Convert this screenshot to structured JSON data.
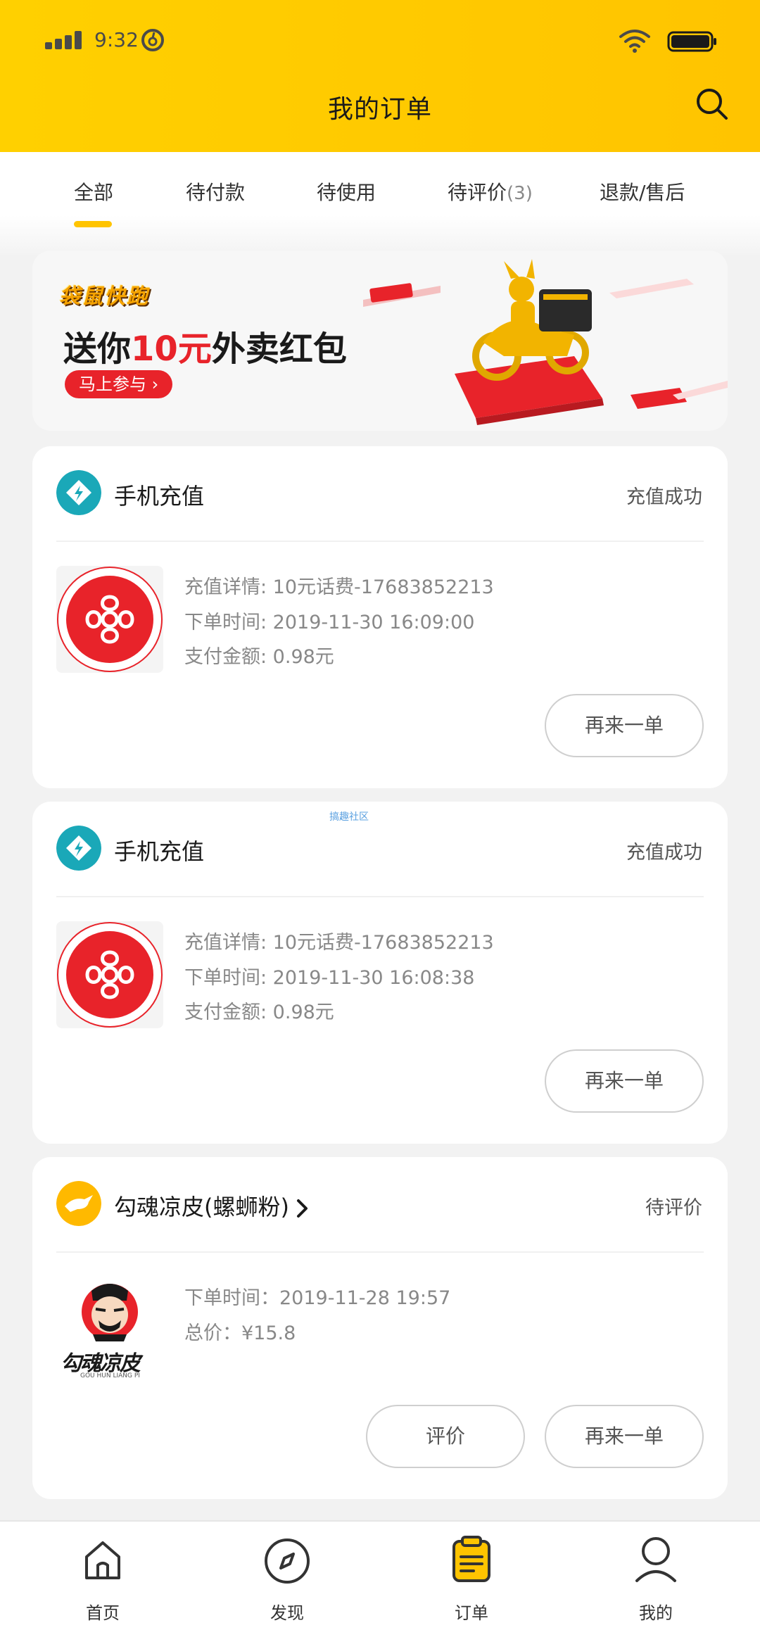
{
  "status_bar": {
    "time": "9:32"
  },
  "header": {
    "title": "我的订单"
  },
  "tabs": [
    {
      "label": "全部",
      "count": ""
    },
    {
      "label": "待付款",
      "count": ""
    },
    {
      "label": "待使用",
      "count": ""
    },
    {
      "label": "待评价",
      "count": "(3)"
    },
    {
      "label": "退款/售后",
      "count": ""
    }
  ],
  "banner": {
    "logo_text": "袋鼠快跑",
    "text_before": "送你",
    "text_highlight": "10元",
    "text_after": "外卖红包",
    "button_label": "马上参与 ›"
  },
  "orders": [
    {
      "shop_name": "手机充值",
      "status": "充值成功",
      "details": [
        "充值详情: 10元话费-17683852213",
        "下单时间: 2019-11-30 16:09:00",
        "支付金额: 0.98元"
      ],
      "actions": [
        "再来一单"
      ]
    },
    {
      "shop_name": "手机充值",
      "status": "充值成功",
      "details": [
        "充值详情: 10元话费-17683852213",
        "下单时间: 2019-11-30 16:08:38",
        "支付金额: 0.98元"
      ],
      "actions": [
        "再来一单"
      ]
    },
    {
      "shop_name": "勾魂凉皮(螺蛳粉)",
      "status": "待评价",
      "details": [
        "下单时间：2019-11-28 19:57",
        "总价：¥15.8"
      ],
      "actions": [
        "评价",
        "再来一单"
      ],
      "logo_text": "勾魂凉皮",
      "logo_subtext": "GOU HUN LIANG PI"
    }
  ],
  "watermark": "搞趣社区",
  "bottom_nav": [
    {
      "label": "首页",
      "icon": "home-icon"
    },
    {
      "label": "发现",
      "icon": "compass-icon"
    },
    {
      "label": "订单",
      "icon": "order-icon"
    },
    {
      "label": "我的",
      "icon": "profile-icon"
    }
  ],
  "colors": {
    "accent": "#ffc400",
    "brand_red": "#e8232a",
    "teal": "#1aa8b8"
  }
}
